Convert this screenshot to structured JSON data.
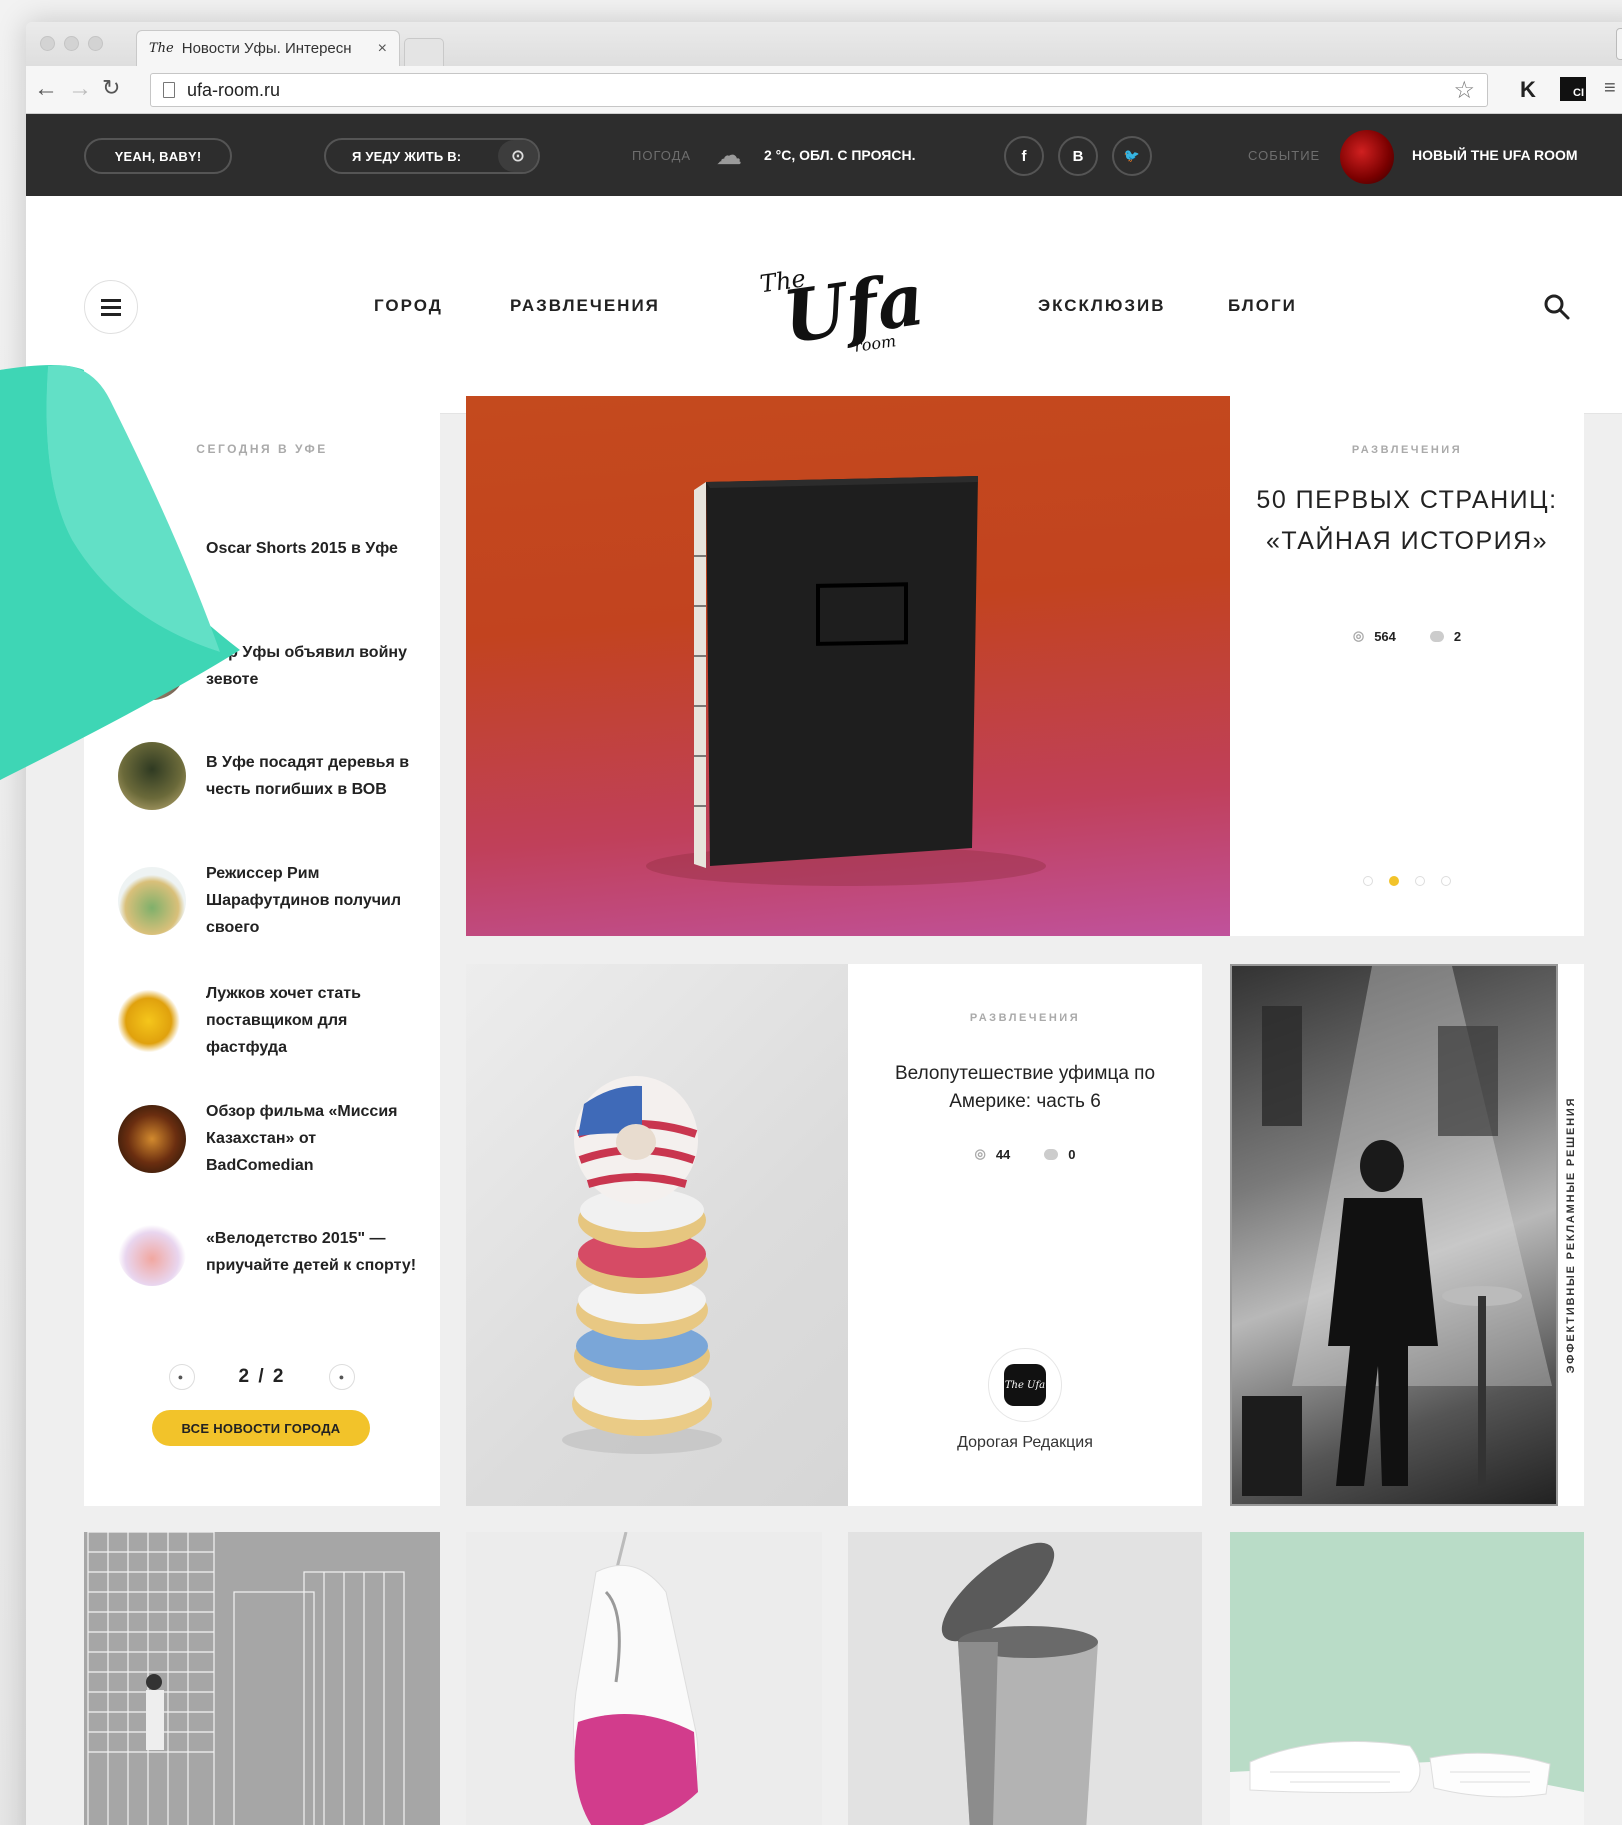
{
  "browser": {
    "tab_title": "Новости Уфы. Интересн",
    "tab_favicon": "The",
    "tab_close": "×",
    "url": "ufa-room.ru"
  },
  "topbar": {
    "yeah_label": "YEAH, BABY!",
    "live_label": "Я УЕДУ ЖИТЬ В:",
    "weather_label": "ПОГОДА",
    "weather_value": "2 °С, ОБЛ. С ПРОЯСН.",
    "social": [
      "f",
      "В",
      "🐦"
    ],
    "event_label": "СОБЫТИЕ",
    "event_value": "НОВЫЙ THE UFA ROOM"
  },
  "menu": {
    "left": [
      "ГОРОД",
      "РАЗВЛЕЧЕНИЯ"
    ],
    "right": [
      "ЭКСКЛЮЗИВ",
      "БЛОГИ"
    ]
  },
  "sidebar": {
    "title": "СЕГОДНЯ В УФЕ",
    "items": [
      "Oscar Shorts 2015 в Уфе",
      "Мэр Уфы объявил войну зевоте",
      "В Уфе посадят деревья в честь погибших в ВОВ",
      "Режиссер Рим Шарафутдинов получил своего",
      "Лужков хочет стать поставщиком для фастфуда",
      "Обзор фильма «Миссия Казахстан» от BadComedian",
      "«Велодетство 2015\" — приучайте детей к спорту!"
    ],
    "pager": "2 / 2",
    "all_button": "ВСЕ НОВОСТИ ГОРОДА"
  },
  "featured": {
    "category": "РАЗВЛЕЧЕНИЯ",
    "title": "50 ПЕРВЫХ СТРАНИЦ: «ТАЙНАЯ ИСТОРИЯ»",
    "views": "564",
    "comments": "2",
    "slide_count": 4,
    "active_slide": 2
  },
  "article2": {
    "category": "РАЗВЛЕЧЕНИЯ",
    "title": "Велопутешествие уфимца по Америке: часть 6",
    "views": "44",
    "comments": "0",
    "author": "Дорогая Редакция",
    "author_logo": "The Ufa"
  },
  "ad": {
    "label": "ЭФФЕКТИВНЫЕ РЕКЛАМНЫЕ РЕШЕНИЯ"
  },
  "colors": {
    "accent_yellow": "#f2c32a",
    "topbar_bg": "#2d2d2d",
    "curl_teal": "#3ed6b5"
  }
}
